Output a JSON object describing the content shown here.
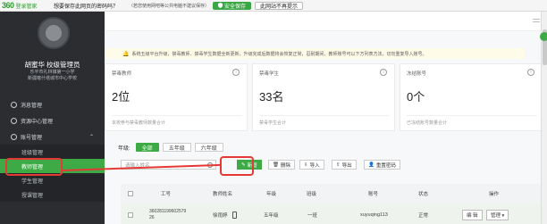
{
  "pwbar": {
    "logo_num": "360",
    "logo_text": "登录管家",
    "question": "想要保存此网页的密码吗？",
    "hint": "（若您使用网吧等公共电脑不建议保存）",
    "save_label": "安全保存",
    "never_label": "此网站不再提示"
  },
  "sidebar": {
    "user_name": "胡蜜华 校级管理员",
    "school_line1": "乐平市礼林镇第一小学",
    "school_line2": "新疆喀什塔城市中心学校",
    "menu": [
      {
        "label": "消息管理"
      },
      {
        "label": "资源中心管理"
      },
      {
        "label": "账号管理"
      }
    ],
    "sub_items": [
      {
        "label": "班级管理"
      },
      {
        "label": "教师管理"
      },
      {
        "label": "学生管理"
      },
      {
        "label": "授课管理"
      }
    ]
  },
  "notice": {
    "text": "系统五级平台升级，禁毒教师、禁毒学生数据全新更新，升级完成后数据将会恢复正常，忍耐期间，教师账号可以下方列表方法，切勿重复导入账号。"
  },
  "cards": [
    {
      "title": "禁毒教师",
      "value": "2位",
      "desc": "本校参与禁毒教师数量合计"
    },
    {
      "title": "禁毒学生",
      "value": "33名",
      "desc": "禁毒学生合计"
    },
    {
      "title": "冻结账号",
      "value": "0个",
      "desc": "已冻结账号数量合计"
    }
  ],
  "grade": {
    "label": "年级:",
    "tabs": [
      "全部",
      "五年级",
      "六年级"
    ]
  },
  "toolbar": {
    "search_placeholder": "请输入姓名",
    "add_label": "新增",
    "delete_label": "删除",
    "import_label": "导入",
    "export_label": "导出",
    "reset_label": "重置密码"
  },
  "table": {
    "headers": [
      "工号",
      "教师姓名",
      "年级",
      "班级",
      "账号",
      "状态",
      "操作"
    ],
    "rows": [
      {
        "id_line1": "360281199602579",
        "id_line2": "26",
        "name": "徐雨婷",
        "grade": "五年级",
        "class": "一班",
        "account": "xuyuqing113",
        "status": "正常",
        "edit_label": "编 辑",
        "manage_label": "管理"
      }
    ]
  },
  "colors": {
    "accent": "#3daa45",
    "sidebar_bg": "#2b2d31",
    "annotation": "#e53935"
  }
}
